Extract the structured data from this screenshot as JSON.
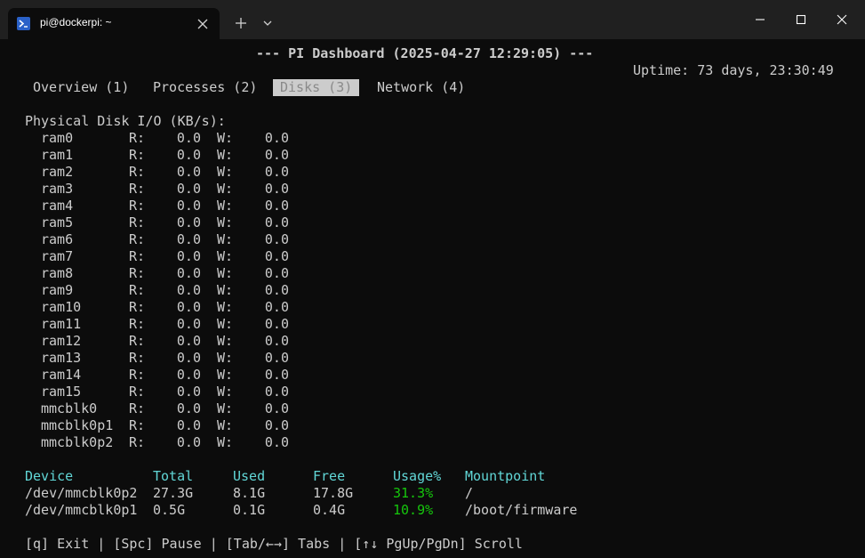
{
  "window": {
    "tab_title": "pi@dockerpi: ~",
    "tab_icon": "powershell-icon",
    "colors": {
      "titlebar": "#202020",
      "terminal_bg": "#0c0c0c",
      "text": "#cccccc",
      "cyan": "#61d6d6",
      "green": "#16c60c",
      "tab_icon_bg": "#2a61c8"
    }
  },
  "dashboard": {
    "header": "--- PI Dashboard (2025-04-27 12:29:05) ---",
    "uptime": "Uptime: 73 days, 23:30:49",
    "tabs": [
      {
        "label": "Overview (1)",
        "active": false
      },
      {
        "label": "Processes (2)",
        "active": false
      },
      {
        "label": "Disks (3)",
        "active": true
      },
      {
        "label": "Network (4)",
        "active": false
      }
    ],
    "disk_io_title": "Physical Disk I/O (KB/s):",
    "disk_io_r_label": "R:",
    "disk_io_w_label": "W:",
    "disk_io": [
      {
        "name": "ram0",
        "r": "0.0",
        "w": "0.0"
      },
      {
        "name": "ram1",
        "r": "0.0",
        "w": "0.0"
      },
      {
        "name": "ram2",
        "r": "0.0",
        "w": "0.0"
      },
      {
        "name": "ram3",
        "r": "0.0",
        "w": "0.0"
      },
      {
        "name": "ram4",
        "r": "0.0",
        "w": "0.0"
      },
      {
        "name": "ram5",
        "r": "0.0",
        "w": "0.0"
      },
      {
        "name": "ram6",
        "r": "0.0",
        "w": "0.0"
      },
      {
        "name": "ram7",
        "r": "0.0",
        "w": "0.0"
      },
      {
        "name": "ram8",
        "r": "0.0",
        "w": "0.0"
      },
      {
        "name": "ram9",
        "r": "0.0",
        "w": "0.0"
      },
      {
        "name": "ram10",
        "r": "0.0",
        "w": "0.0"
      },
      {
        "name": "ram11",
        "r": "0.0",
        "w": "0.0"
      },
      {
        "name": "ram12",
        "r": "0.0",
        "w": "0.0"
      },
      {
        "name": "ram13",
        "r": "0.0",
        "w": "0.0"
      },
      {
        "name": "ram14",
        "r": "0.0",
        "w": "0.0"
      },
      {
        "name": "ram15",
        "r": "0.0",
        "w": "0.0"
      },
      {
        "name": "mmcblk0",
        "r": "0.0",
        "w": "0.0"
      },
      {
        "name": "mmcblk0p1",
        "r": "0.0",
        "w": "0.0"
      },
      {
        "name": "mmcblk0p2",
        "r": "0.0",
        "w": "0.0"
      }
    ],
    "fs_headers": {
      "device": "Device",
      "total": "Total",
      "used": "Used",
      "free": "Free",
      "usage": "Usage%",
      "mountpoint": "Mountpoint"
    },
    "filesystems": [
      {
        "device": "/dev/mmcblk0p2",
        "total": "27.3G",
        "used": "8.1G",
        "free": "17.8G",
        "usage": "31.3%",
        "mountpoint": "/"
      },
      {
        "device": "/dev/mmcblk0p1",
        "total": "0.5G",
        "used": "0.1G",
        "free": "0.4G",
        "usage": "10.9%",
        "mountpoint": "/boot/firmware"
      }
    ],
    "footer": "[q] Exit | [Spc] Pause | [Tab/←→] Tabs | [↑↓ PgUp/PgDn] Scroll"
  }
}
